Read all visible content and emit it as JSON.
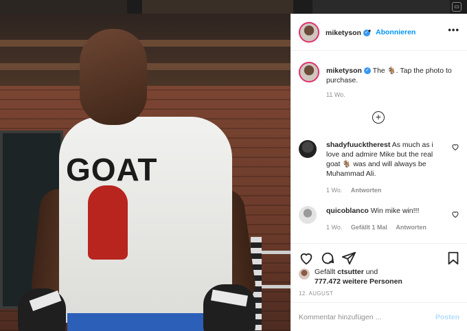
{
  "post": {
    "username": "miketyson",
    "follow_label": "Abonnieren",
    "caption_text": "The 🐐. Tap the photo to purchase.",
    "caption_time": "11 Wo.",
    "shirt_print": "GOAT"
  },
  "comments": [
    {
      "username": "shadyfuucktherest",
      "text": "As much as i love and admire Mike but the real goat 🐐 was and will always be Muhammad Ali.",
      "time": "1 Wo.",
      "likes": "",
      "reply_label": "Antworten"
    },
    {
      "username": "quicoblanco",
      "text": "Win mike win!!!",
      "time": "1 Wo.",
      "likes": "Gefällt 1 Mal",
      "reply_label": "Antworten"
    }
  ],
  "likes": {
    "liked_by_prefix": "Gefällt ",
    "liked_by_user": "ctsutter",
    "liked_by_suffix": " und",
    "others": "777.472 weitere Personen"
  },
  "date": "12. AUGUST",
  "comment_box": {
    "placeholder": "Kommentar hinzufügen ...",
    "post_label": "Posten"
  },
  "icons": {
    "like": "heart-icon",
    "comment": "comment-icon",
    "share": "share-icon",
    "save": "bookmark-icon",
    "more": "more-icon",
    "verified": "verified-badge-icon",
    "add": "plus-circle-icon"
  },
  "colors": {
    "accent": "#0095f6",
    "verified": "#3897f0",
    "post_disabled": "#b3dbff"
  }
}
